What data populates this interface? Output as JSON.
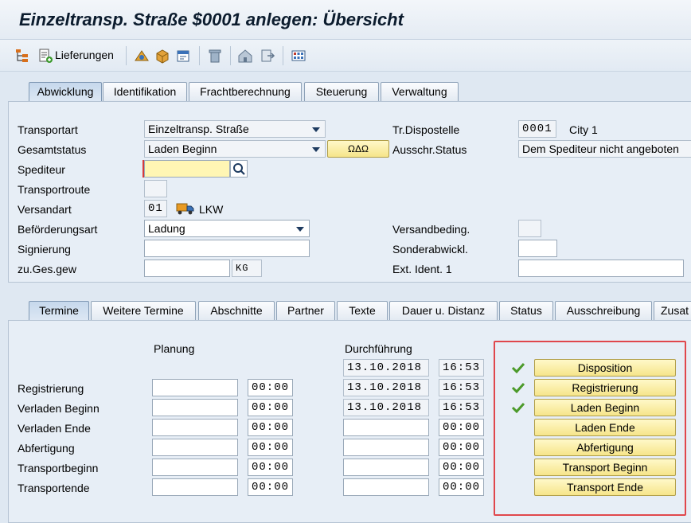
{
  "window": {
    "title": "Einzeltransp. Straße $0001 anlegen: Übersicht"
  },
  "toolbar": {
    "deliveries_label": "Lieferungen",
    "icons": [
      "hierarchy-icon",
      "deliveries-icon",
      "compare-icon",
      "package-icon",
      "schedule-icon",
      "delete-icon",
      "home-icon",
      "export-icon",
      "grid-icon"
    ]
  },
  "header_tabs": [
    {
      "label": "Abwicklung",
      "active": true
    },
    {
      "label": "Identifikation",
      "active": false
    },
    {
      "label": "Frachtberechnung",
      "active": false
    },
    {
      "label": "Steuerung",
      "active": false
    },
    {
      "label": "Verwaltung",
      "active": false
    }
  ],
  "header_fields": {
    "transportart": {
      "label": "Transportart",
      "value": "Einzeltransp. Straße"
    },
    "gesamtstatus": {
      "label": "Gesamtstatus",
      "value": "Laden Beginn",
      "button": "ΩΔΩ"
    },
    "spediteur": {
      "label": "Spediteur",
      "value": ""
    },
    "transportroute": {
      "label": "Transportroute",
      "value": ""
    },
    "versandart": {
      "label": "Versandart",
      "code": "01",
      "text": "LKW"
    },
    "befoerderungsart": {
      "label": "Beförderungsart",
      "value": "Ladung"
    },
    "signierung": {
      "label": "Signierung",
      "value": ""
    },
    "zu_ges_gew": {
      "label": "zu.Ges.gew",
      "value": "",
      "unit": "KG"
    },
    "tr_dispostelle": {
      "label": "Tr.Dispostelle",
      "code": "0001",
      "text": "City 1"
    },
    "ausschr_status": {
      "label": "Ausschr.Status",
      "value": "Dem Spediteur nicht angeboten"
    },
    "versandbeding": {
      "label": "Versandbeding.",
      "value": ""
    },
    "sonderabwickl": {
      "label": "Sonderabwickl.",
      "value": ""
    },
    "ext_ident": {
      "label": "Ext. Ident. 1",
      "value": ""
    }
  },
  "detail_tabs": [
    {
      "label": "Termine",
      "active": true
    },
    {
      "label": "Weitere Termine",
      "active": false
    },
    {
      "label": "Abschnitte",
      "active": false
    },
    {
      "label": "Partner",
      "active": false
    },
    {
      "label": "Texte",
      "active": false
    },
    {
      "label": "Dauer u. Distanz",
      "active": false
    },
    {
      "label": "Status",
      "active": false
    },
    {
      "label": "Ausschreibung",
      "active": false
    },
    {
      "label": "Zusat",
      "active": false
    }
  ],
  "termine": {
    "planung_header": "Planung",
    "durchfuehrung_header": "Durchführung",
    "top_row": {
      "date": "13.10.2018",
      "time": "16:53"
    },
    "rows": [
      {
        "label": "Registrierung",
        "plan_date": "",
        "plan_time": "00:00",
        "exec_date": "13.10.2018",
        "exec_time": "16:53"
      },
      {
        "label": "Verladen Beginn",
        "plan_date": "",
        "plan_time": "00:00",
        "exec_date": "13.10.2018",
        "exec_time": "16:53"
      },
      {
        "label": "Verladen Ende",
        "plan_date": "",
        "plan_time": "00:00",
        "exec_date": "",
        "exec_time": "00:00"
      },
      {
        "label": "Abfertigung",
        "plan_date": "",
        "plan_time": "00:00",
        "exec_date": "",
        "exec_time": "00:00"
      },
      {
        "label": "Transportbeginn",
        "plan_date": "",
        "plan_time": "00:00",
        "exec_date": "",
        "exec_time": "00:00"
      },
      {
        "label": "Transportende",
        "plan_date": "",
        "plan_time": "00:00",
        "exec_date": "",
        "exec_time": "00:00"
      }
    ],
    "status_buttons": [
      {
        "label": "Disposition",
        "done": true
      },
      {
        "label": "Registrierung",
        "done": true
      },
      {
        "label": "Laden Beginn",
        "done": true
      },
      {
        "label": "Laden Ende",
        "done": false
      },
      {
        "label": "Abfertigung",
        "done": false
      },
      {
        "label": "Transport Beginn",
        "done": false
      },
      {
        "label": "Transport Ende",
        "done": false
      }
    ]
  },
  "colors": {
    "background": "#dfe8f2",
    "status_button": "#f6e58a",
    "check": "#4c9a2a",
    "highlight": "#e0474c"
  }
}
